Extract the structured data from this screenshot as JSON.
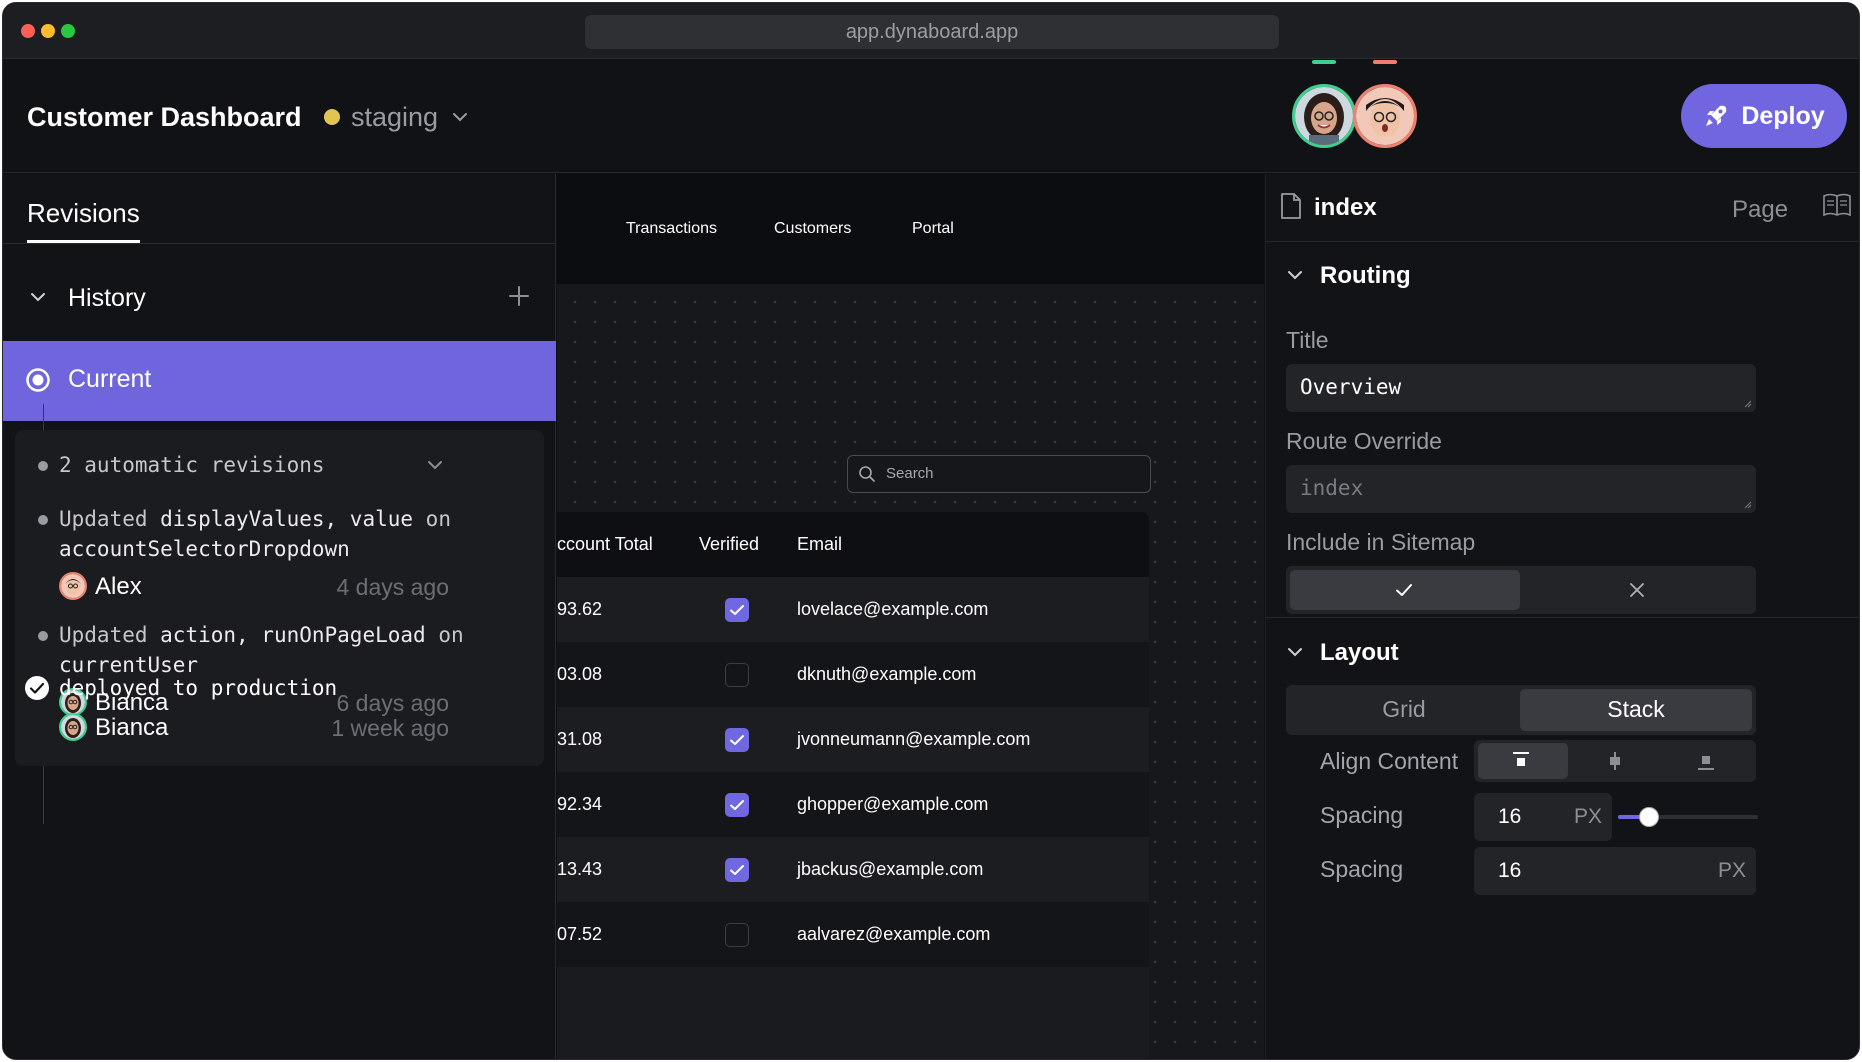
{
  "browser": {
    "url": "app.dynaboard.app"
  },
  "header": {
    "title": "Customer Dashboard",
    "environment": "staging",
    "deploy_label": "Deploy"
  },
  "revisions": {
    "tab_label": "Revisions",
    "history_label": "History",
    "current_label": "Current",
    "automatic_label": "2 automatic revisions",
    "items": [
      {
        "prefix": "Updated ",
        "code": "displayValues, value",
        "suffix": " on",
        "line2": "accountSelectorDropdown",
        "user": "Alex",
        "time": "4 days ago"
      },
      {
        "prefix": "Updated ",
        "code": "action, runOnPageLoad",
        "suffix": " on",
        "line2": "currentUser",
        "user": "Bianca",
        "time": "6 days ago"
      }
    ],
    "deployed": {
      "text": "deployed to production",
      "user": "Bianca",
      "time": "1 week ago"
    }
  },
  "canvas": {
    "nav": [
      "Transactions",
      "Customers",
      "Portal"
    ],
    "search_placeholder": "Search",
    "columns": [
      "ccount Total",
      "Verified",
      "Email"
    ],
    "rows": [
      {
        "total": "93.62",
        "verified": true,
        "email": "lovelace@example.com"
      },
      {
        "total": "03.08",
        "verified": false,
        "email": "dknuth@example.com"
      },
      {
        "total": "31.08",
        "verified": true,
        "email": "jvonneumann@example.com"
      },
      {
        "total": "92.34",
        "verified": true,
        "email": "ghopper@example.com"
      },
      {
        "total": "13.43",
        "verified": true,
        "email": "jbackus@example.com"
      },
      {
        "total": "07.52",
        "verified": false,
        "email": "aalvarez@example.com"
      }
    ]
  },
  "inspector": {
    "page_name": "index",
    "page_type": "Page",
    "routing": {
      "title": "Routing",
      "title_label": "Title",
      "title_value": "Overview",
      "route_label": "Route Override",
      "route_placeholder": "index",
      "sitemap_label": "Include in Sitemap",
      "sitemap_value": true
    },
    "layout": {
      "title": "Layout",
      "modes": [
        "Grid",
        "Stack"
      ],
      "selected_mode": "Stack",
      "align_label": "Align Content",
      "align_selected": "top",
      "spacing_label": "Spacing",
      "spacing_value": "16",
      "spacing_unit": "PX",
      "spacing_slider_fraction": 0.22,
      "spacing2_label": "Spacing",
      "spacing2_value": "16",
      "spacing2_unit": "PX"
    }
  },
  "colors": {
    "accent": "#6f66e0",
    "env_dot": "#e2c452",
    "presence_green": "#3fcf8e",
    "presence_red": "#f07f6f"
  }
}
